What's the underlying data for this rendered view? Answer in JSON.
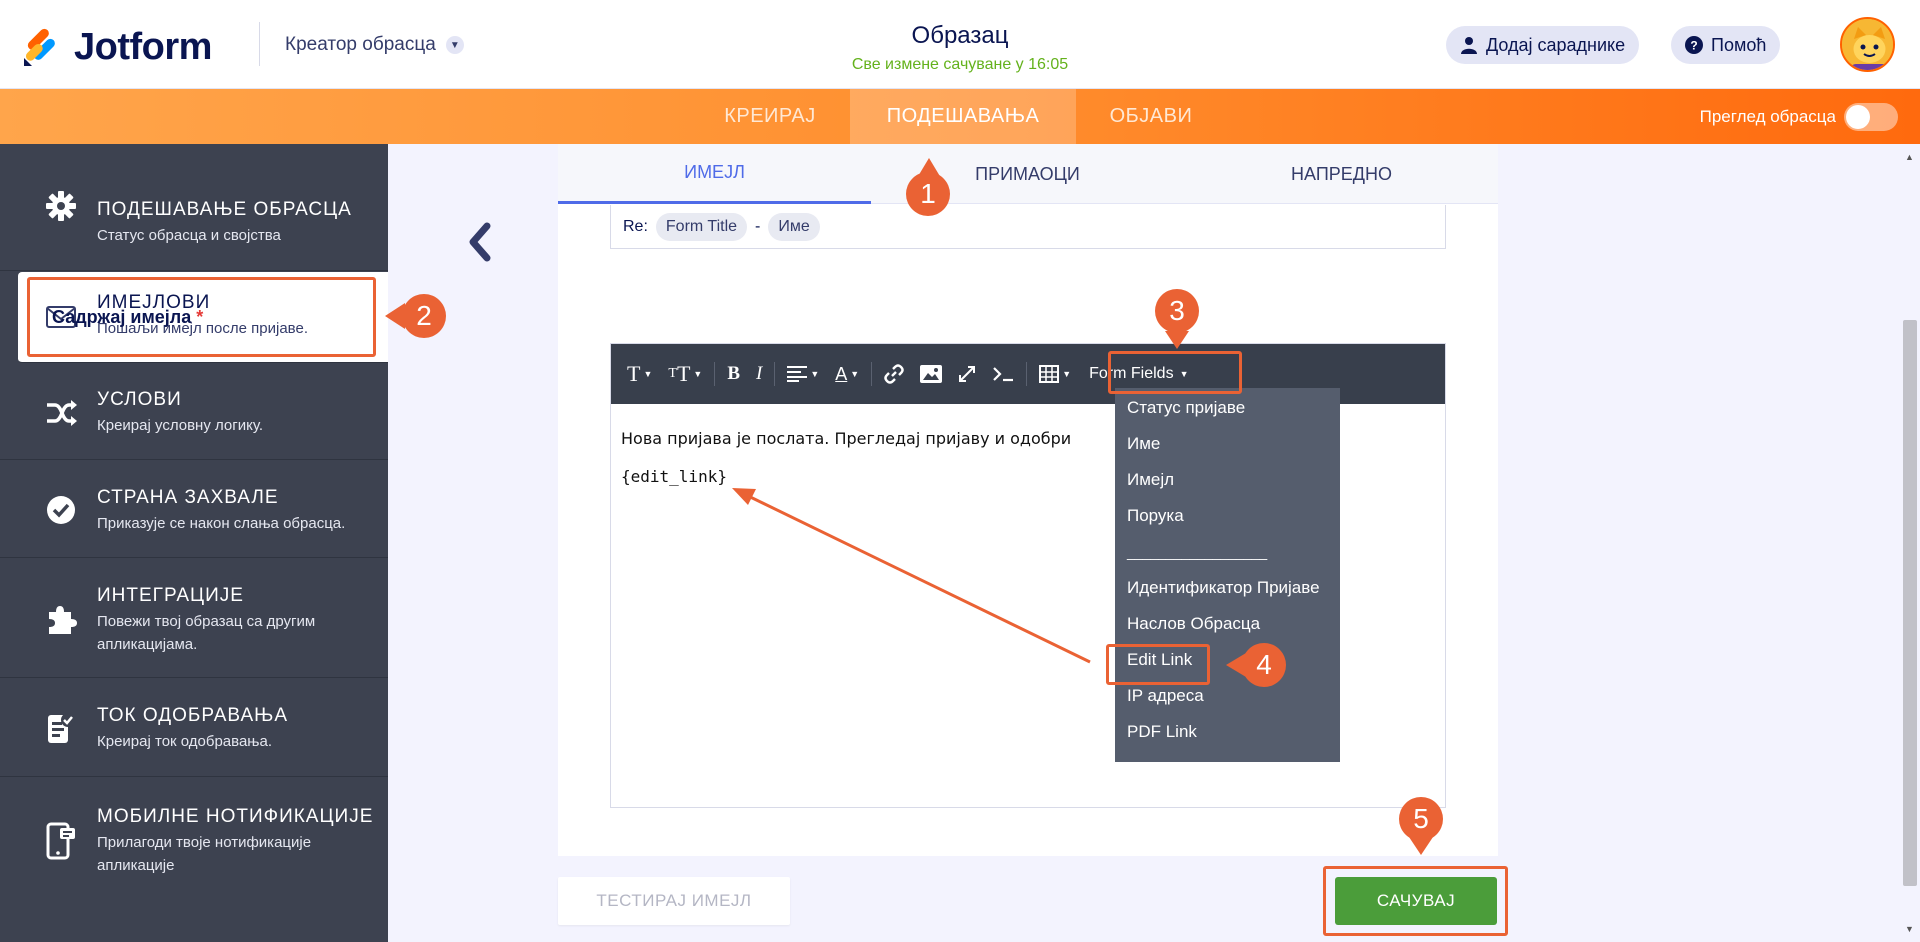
{
  "header": {
    "brand": "Jotform",
    "builder_label": "Креатор обрасца",
    "form_title": "Образац",
    "saved_status": "Све измене сачуване у 16:05",
    "add_collaborators": "Додај сараднике",
    "help": "Помоћ"
  },
  "nav": {
    "tabs": [
      {
        "label": "КРЕИРАЈ",
        "active": false
      },
      {
        "label": "ПОДЕШАВАЊА",
        "active": true
      },
      {
        "label": "ОБЈАВИ",
        "active": false
      }
    ],
    "preview_label": "Преглед обрасца"
  },
  "sidebar": {
    "items": [
      {
        "title": "ПОДЕШАВАЊЕ ОБРАСЦА",
        "desc": "Статус обрасца и својства",
        "icon": "gear-icon"
      },
      {
        "title": "ИМЕЈЛОВИ",
        "desc": "Пошаљи имејл после пријаве.",
        "icon": "envelope-icon"
      },
      {
        "title": "УСЛОВИ",
        "desc": "Креирај условну логику.",
        "icon": "shuffle-icon"
      },
      {
        "title": "СТРАНА ЗАХВАЛЕ",
        "desc": "Приказује се након слања обрасца.",
        "icon": "check-circle-icon"
      },
      {
        "title": "ИНТЕГРАЦИЈЕ",
        "desc": "Повежи твој образац са другим апликацијама.",
        "icon": "puzzle-icon"
      },
      {
        "title": "ТОК ОДОБРАВАЊА",
        "desc": "Креирај ток одобравања.",
        "icon": "approval-icon"
      },
      {
        "title": "МОБИЛНЕ НОТИФИКАЦИЈЕ",
        "desc": "Прилагоди твоје нотификације апликације",
        "icon": "mobile-icon"
      }
    ]
  },
  "email_tabs": [
    {
      "label": "ИМЕЈЛ",
      "active": true
    },
    {
      "label": "ПРИМАОЦИ",
      "active": false
    },
    {
      "label": "НАПРЕДНО",
      "active": false
    }
  ],
  "subject": {
    "prefix": "Re:",
    "chip1": "Form Title",
    "separator": "-",
    "chip2": "Име"
  },
  "content": {
    "label": "Садржај имејла",
    "required_mark": "*",
    "line1": "Нова пријава је послата. Прегледај пријаву и одобри",
    "line2": "{edit_link}"
  },
  "toolbar": {
    "form_fields_label": "Form Fields"
  },
  "dropdown": {
    "items": [
      "Статус пријаве",
      "Име",
      "Имејл",
      "Порука",
      "__________________",
      "Идентификатор Пријаве",
      "Наслов Обрасца",
      "Edit Link",
      "IP адреса",
      "PDF Link"
    ]
  },
  "buttons": {
    "test_email": "ТЕСТИРАЈ ИМЕЈЛ",
    "save": "САЧУВАЈ"
  },
  "annotations": {
    "m1": "1",
    "m2": "2",
    "m3": "3",
    "m4": "4",
    "m5": "5"
  },
  "colors": {
    "accent": "#ff6100",
    "annotation": "#ea6234",
    "save_green": "#4b9d3a",
    "sidebar_bg": "#3d4250",
    "saved_green": "#64b21c"
  }
}
